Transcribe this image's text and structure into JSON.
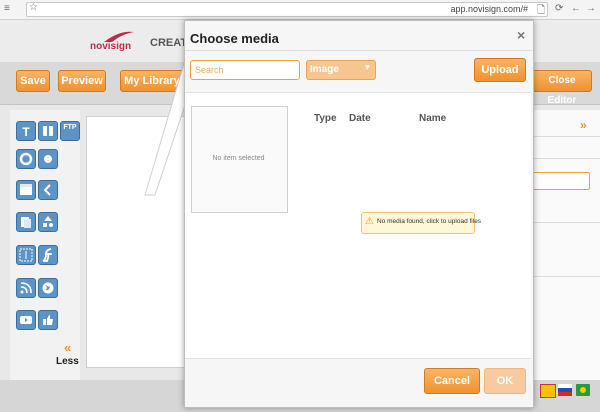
{
  "browser": {
    "url": "app.novisign.com/#",
    "menu_glyph": "≡",
    "star_glyph": "☆",
    "file_glyph": "🗋",
    "reload_glyph": "⟳",
    "back_glyph": "←",
    "forward_glyph": "→"
  },
  "header": {
    "brand": "novisign",
    "section": "CREATIVE"
  },
  "toolbar": {
    "save_label": "Save",
    "preview_label": "Preview",
    "library_label": "My Library",
    "close_label": "Close Editor"
  },
  "left_panel": {
    "tools": [
      "T",
      "",
      "FTP",
      "",
      "",
      "",
      "",
      "",
      "",
      "",
      "",
      "",
      "",
      "",
      ""
    ],
    "less_label": "Less",
    "less_glyph": "«"
  },
  "right_panel": {
    "expand_glyph": "»"
  },
  "modal": {
    "title": "Choose media",
    "close_glyph": "×",
    "search_placeholder": "Search",
    "type_value": "Image",
    "select_arrow": "▾",
    "upload_label": "Upload",
    "preview_text": "No item selected",
    "columns": [
      "Type",
      "Date",
      "Name"
    ],
    "notice_icon": "⚠",
    "notice_text": "No media found, click to upload files",
    "cancel_label": "Cancel",
    "ok_label": "OK"
  },
  "colors": {
    "accent": "#f0922e",
    "tool_blue": "#5d93c5",
    "brand": "#c22a4c"
  }
}
